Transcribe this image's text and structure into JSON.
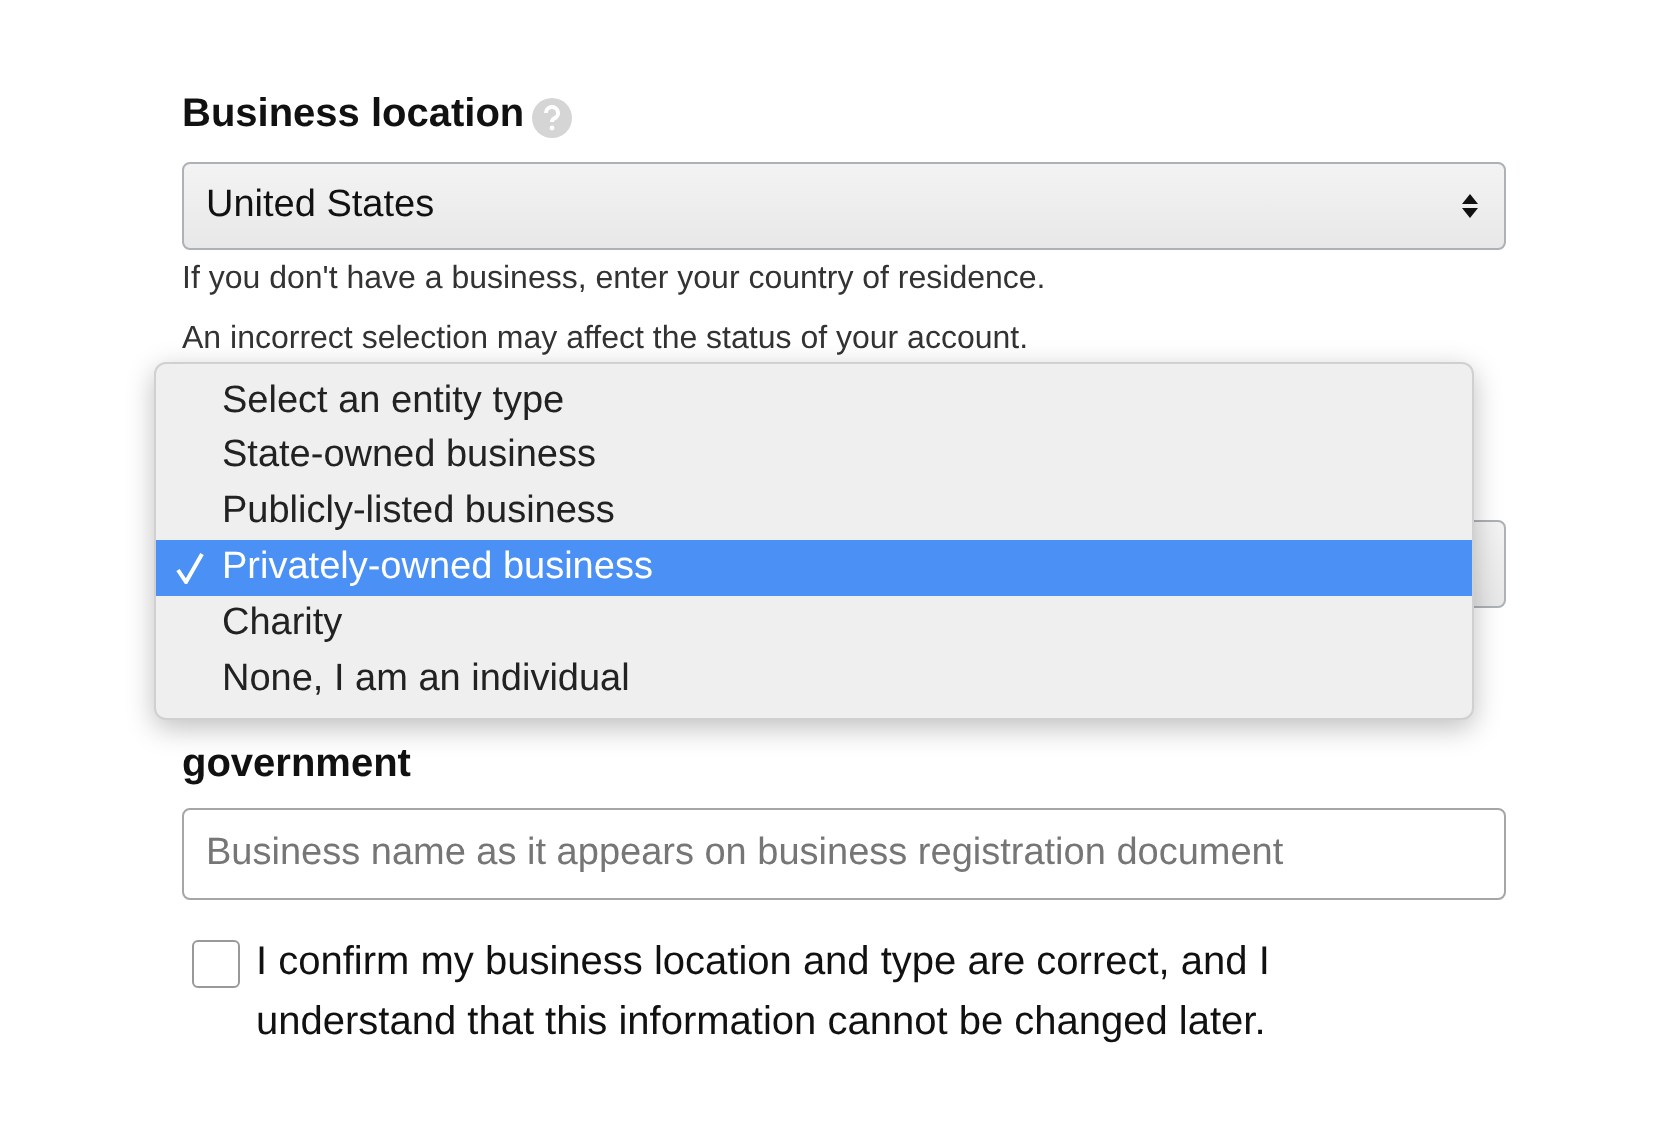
{
  "location": {
    "label": "Business location",
    "value": "United States",
    "hints": [
      "If you don't have a business, enter your country of residence.",
      "An incorrect selection may affect the status of your account."
    ]
  },
  "entity_menu": {
    "options": [
      {
        "label": "Select an entity type",
        "selected": false
      },
      {
        "label": "State-owned business",
        "selected": false
      },
      {
        "label": "Publicly-listed business",
        "selected": false
      },
      {
        "label": "Privately-owned business",
        "selected": true
      },
      {
        "label": "Charity",
        "selected": false
      },
      {
        "label": "None, I am an individual",
        "selected": false
      }
    ]
  },
  "business_name": {
    "label": "government",
    "placeholder": "Business name as it appears on business registration document"
  },
  "confirm": {
    "label": "I confirm my business location and type are correct, and I understand that this information cannot be changed later.",
    "checked": false
  }
}
